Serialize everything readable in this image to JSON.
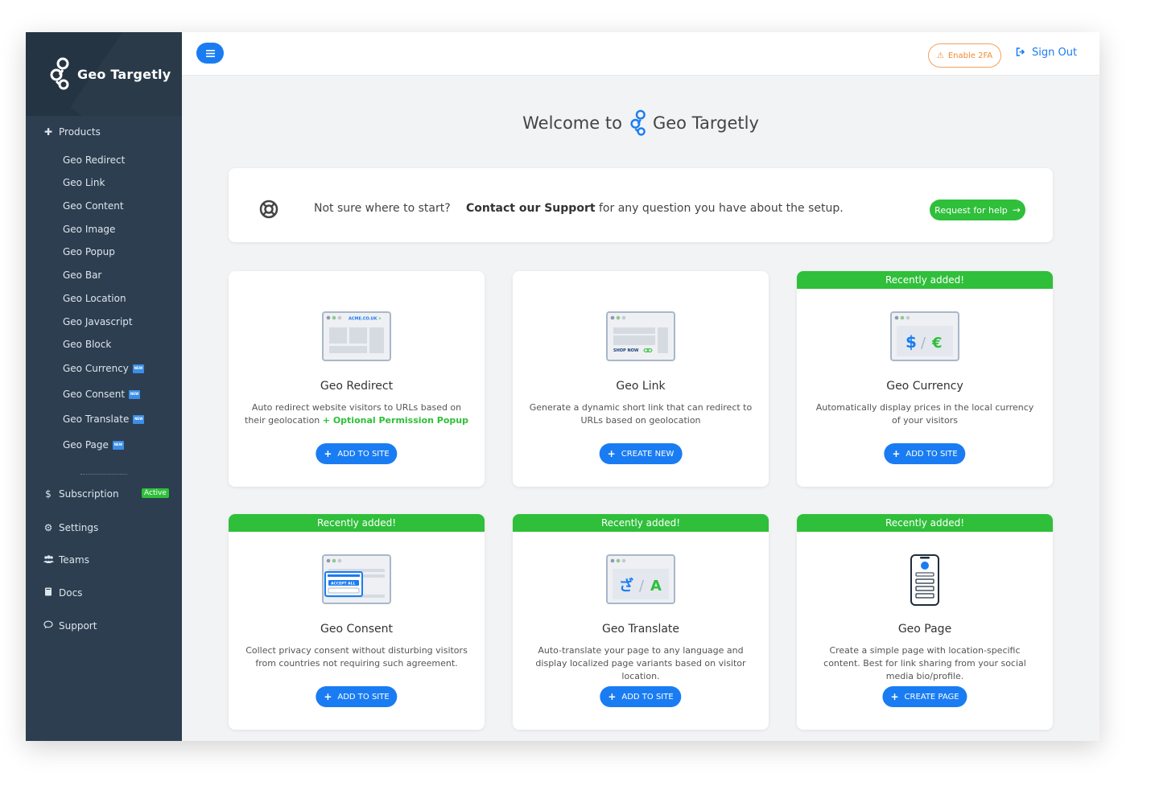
{
  "brand": {
    "name": "Geo Targetly"
  },
  "sidebar": {
    "products_label": "Products",
    "products": [
      {
        "label": "Geo Redirect",
        "new": false
      },
      {
        "label": "Geo Link",
        "new": false
      },
      {
        "label": "Geo Content",
        "new": false
      },
      {
        "label": "Geo Image",
        "new": false
      },
      {
        "label": "Geo Popup",
        "new": false
      },
      {
        "label": "Geo Bar",
        "new": false
      },
      {
        "label": "Geo Location",
        "new": false
      },
      {
        "label": "Geo Javascript",
        "new": false
      },
      {
        "label": "Geo Block",
        "new": false
      },
      {
        "label": "Geo Currency",
        "new": true
      },
      {
        "label": "Geo Consent",
        "new": true
      },
      {
        "label": "Geo Translate",
        "new": true
      },
      {
        "label": "Geo Page",
        "new": true
      }
    ],
    "new_badge": "NEW",
    "subscription_label": "Subscription",
    "subscription_status": "Active",
    "settings_label": "Settings",
    "teams_label": "Teams",
    "docs_label": "Docs",
    "support_label": "Support"
  },
  "topbar": {
    "enable_2fa": "Enable 2FA",
    "sign_out": "Sign Out"
  },
  "welcome": {
    "prefix": "Welcome to",
    "brand": "Geo Targetly"
  },
  "support_card": {
    "question": "Not sure where to start?",
    "contact_bold": "Contact our Support",
    "contact_rest": " for any question you have about the setup.",
    "button": "Request for help"
  },
  "ribbon_text": "Recently added!",
  "cards": [
    {
      "title": "Geo Redirect",
      "desc": "Auto redirect website visitors to URLs based on their geolocation",
      "desc_extra": "+ Optional Permission Popup",
      "button": "ADD TO SITE",
      "recent": false,
      "icon": "redirect-browser-icon",
      "illus_text": "ACME.CO.UK"
    },
    {
      "title": "Geo Link",
      "desc": "Generate a dynamic short link that can redirect to URLs based on geolocation",
      "desc_extra": "",
      "button": "CREATE NEW",
      "recent": false,
      "icon": "link-browser-icon",
      "illus_text": "SHOP NOW"
    },
    {
      "title": "Geo Currency",
      "desc": "Automatically display prices in the local currency of your visitors",
      "desc_extra": "",
      "button": "ADD TO SITE",
      "recent": true,
      "icon": "currency-browser-icon",
      "illus_text": "$ / €"
    },
    {
      "title": "Geo Consent",
      "desc": "Collect privacy consent without disturbing visitors from countries not requiring such agreement.",
      "desc_extra": "",
      "button": "ADD TO SITE",
      "recent": true,
      "icon": "consent-browser-icon",
      "illus_text": "ACCEPT ALL"
    },
    {
      "title": "Geo Translate",
      "desc": "Auto-translate your page to any language and display localized page variants based on visitor location.",
      "desc_extra": "",
      "button": "ADD TO SITE",
      "recent": true,
      "icon": "translate-browser-icon",
      "illus_text": "ざ / A"
    },
    {
      "title": "Geo Page",
      "desc": "Create a simple page with location-specific content. Best for link sharing from your social media bio/profile.",
      "desc_extra": "",
      "button": "CREATE PAGE",
      "recent": true,
      "icon": "phone-page-icon",
      "illus_text": ""
    }
  ]
}
